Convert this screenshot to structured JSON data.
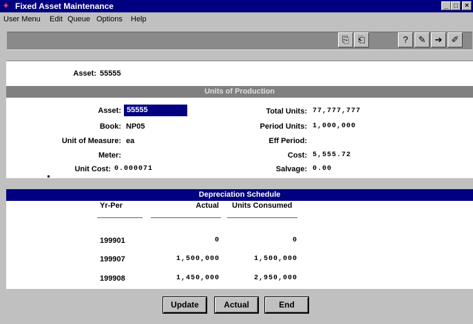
{
  "window": {
    "title": "Fixed Asset Maintenance",
    "app_icon": "app-icon",
    "controls": {
      "minimize": "_",
      "maximize": "□",
      "close": "×"
    }
  },
  "menu": [
    "User Menu",
    "Edit",
    "Queue",
    "Options",
    "Help"
  ],
  "toolbar": {
    "buttons": [
      "copy-icon",
      "paste-icon",
      "query-icon",
      "edit-doc-icon",
      "next-doc-icon",
      "pencil-icon"
    ]
  },
  "header": {
    "label": "Asset:",
    "value": "55555"
  },
  "units_section": {
    "title": "Units of Production",
    "left": {
      "asset_label": "Asset:",
      "asset_value": "55555",
      "book_label": "Book:",
      "book_value": "NP05",
      "uom_label": "Unit of Measure:",
      "uom_value": "ea",
      "meter_label": "Meter:",
      "meter_value": "",
      "unit_cost_label": "Unit Cost:",
      "unit_cost_value": "0.000071"
    },
    "right": {
      "total_units_label": "Total Units:",
      "total_units_value": "77,777,777",
      "period_units_label": "Period Units:",
      "period_units_value": "1,000,000",
      "eff_period_label": "Eff Period:",
      "eff_period_value": "",
      "cost_label": "Cost:",
      "cost_value": "5,555.72",
      "salvage_label": "Salvage:",
      "salvage_value": "0.00"
    }
  },
  "schedule": {
    "title": "Depreciation Schedule",
    "columns": [
      "Yr-Per",
      "Actual",
      "Units Consumed"
    ],
    "rows": [
      {
        "yr_per": "199901",
        "actual": "0",
        "units": "0"
      },
      {
        "yr_per": "199907",
        "actual": "1,500,000",
        "units": "1,500,000"
      },
      {
        "yr_per": "199908",
        "actual": "1,450,000",
        "units": "2,950,000"
      }
    ]
  },
  "buttons": {
    "update": "Update",
    "actual": "Actual",
    "end": "End"
  },
  "colors": {
    "title_bar": "#000080",
    "section_gray": "#808080",
    "field_highlight": "#000080"
  }
}
